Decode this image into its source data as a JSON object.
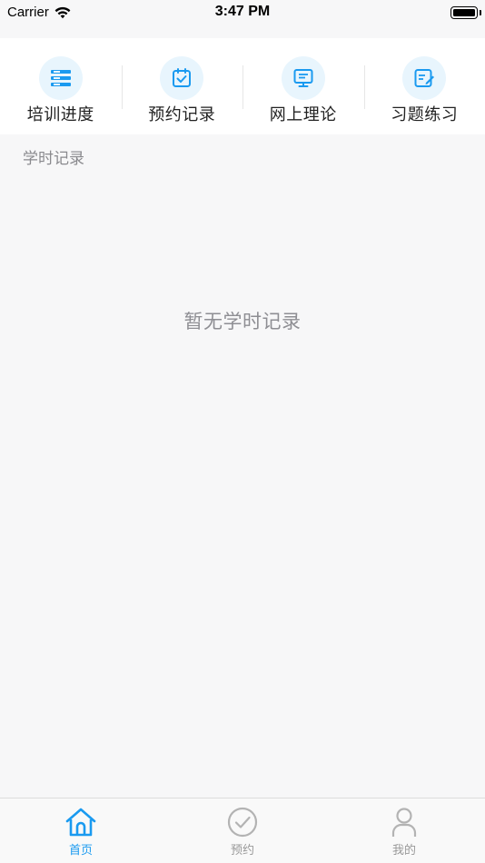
{
  "status_bar": {
    "carrier": "Carrier",
    "time": "3:47 PM"
  },
  "menu": [
    {
      "label": "培训进度",
      "icon": "list-icon"
    },
    {
      "label": "预约记录",
      "icon": "calendar-check-icon"
    },
    {
      "label": "网上理论",
      "icon": "monitor-icon"
    },
    {
      "label": "习题练习",
      "icon": "edit-note-icon"
    }
  ],
  "section": {
    "title": "学时记录",
    "empty_text": "暂无学时记录"
  },
  "tabs": [
    {
      "label": "首页",
      "icon": "home-icon",
      "active": true
    },
    {
      "label": "预约",
      "icon": "check-circle-icon",
      "active": false
    },
    {
      "label": "我的",
      "icon": "person-icon",
      "active": false
    }
  ],
  "colors": {
    "accent": "#1a9af0",
    "icon_bg": "#e8f5fd",
    "page_bg": "#f7f7f8",
    "inactive": "#b3b3b3"
  }
}
